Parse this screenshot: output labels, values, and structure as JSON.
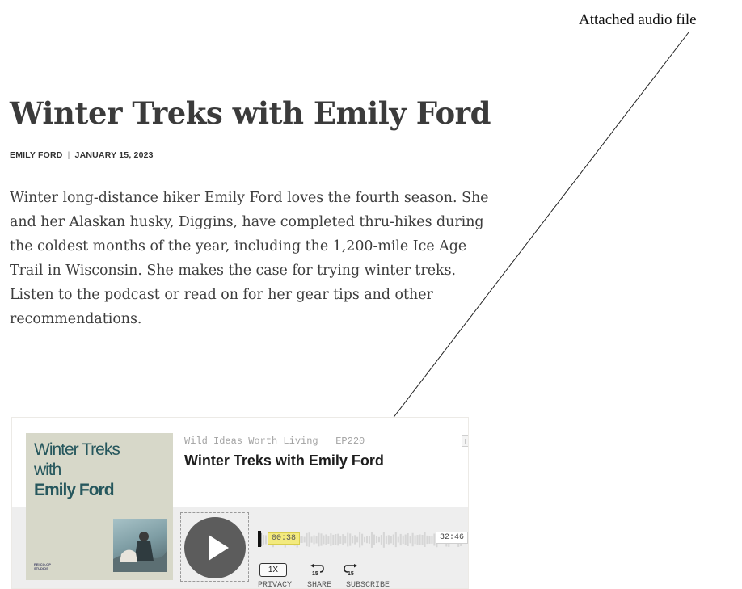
{
  "annotation": {
    "label": "Attached audio file"
  },
  "article": {
    "title": "Winter Treks with Emily Ford",
    "author": "EMILY FORD",
    "separator": "|",
    "date": "JANUARY 15, 2023",
    "intro": "Winter long-distance hiker Emily Ford loves the fourth season. She and her Alaskan husky, Diggins, have completed thru-hikes during the coldest months of the year, including the 1,200-mile Ice Age Trail in Wisconsin. She makes the case for trying winter treks. Listen to the podcast or read on for her gear tips and other recommendations."
  },
  "player": {
    "cover": {
      "line1": "Winter Treks",
      "line2": "with",
      "line3": "Emily Ford",
      "logo": "REI CO-OP STUDIOS"
    },
    "show_line": "Wild Ideas Worth Living | EP220",
    "episode_title": "Winter Treks with Emily Ford",
    "current_time": "00:38",
    "total_time": "32:46",
    "progress_fraction": 0.019,
    "speed_label": "1X",
    "skip_back_seconds": "15",
    "skip_forward_seconds": "15",
    "links": {
      "privacy": "PRIVACY",
      "share": "SHARE",
      "subscribe": "SUBSCRIBE"
    },
    "icons": {
      "play": "play-icon",
      "corner": "embed-icon",
      "skip_back": "rewind-15-icon",
      "skip_forward": "forward-15-icon"
    }
  },
  "colors": {
    "cover_bg": "#d7d8c9",
    "cover_text": "#26575d",
    "play_button": "#5c5c5c",
    "time_highlight": "#f3ea7e",
    "player_bar_bg": "#eeeeee"
  }
}
